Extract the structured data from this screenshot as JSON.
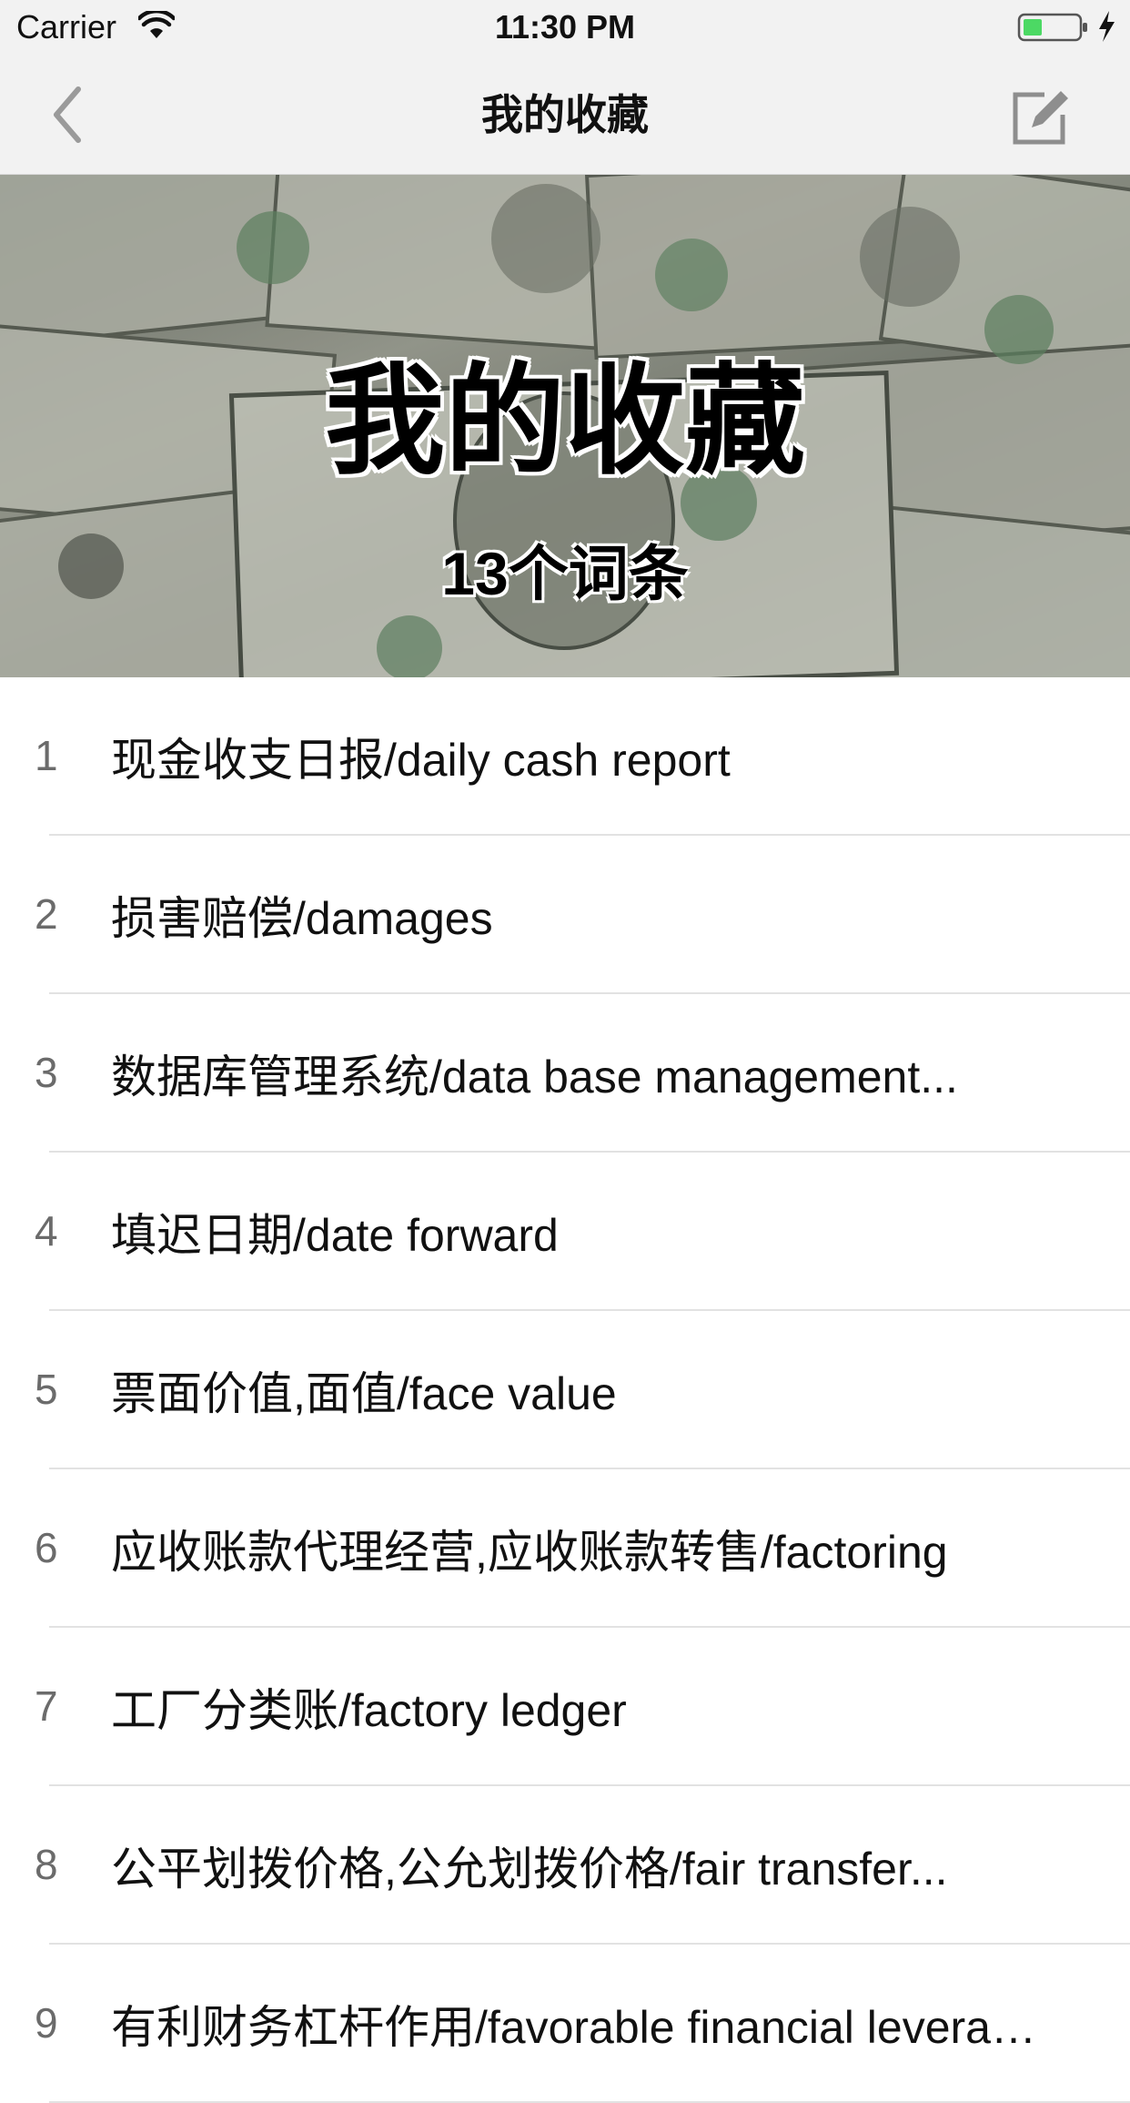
{
  "status_bar": {
    "carrier": "Carrier",
    "time": "11:30 PM"
  },
  "nav": {
    "title": "我的收藏",
    "back_icon": "chevron-left-icon",
    "edit_icon": "edit-icon"
  },
  "banner": {
    "title": "我的收藏",
    "count": "13个词条"
  },
  "items": [
    {
      "index": "1",
      "text": "现金收支日报/daily cash report"
    },
    {
      "index": "2",
      "text": "损害赔偿/damages"
    },
    {
      "index": "3",
      "text": "数据库管理系统/data base management..."
    },
    {
      "index": "4",
      "text": "填迟日期/date forward"
    },
    {
      "index": "5",
      "text": "票面价值,面值/face value"
    },
    {
      "index": "6",
      "text": "应收账款代理经营,应收账款转售/factoring"
    },
    {
      "index": "7",
      "text": "工厂分类账/factory ledger"
    },
    {
      "index": "8",
      "text": "公平划拨价格,公允划拨价格/fair transfer..."
    },
    {
      "index": "9",
      "text": "有利财务杠杆作用/favorable financial leverage"
    }
  ],
  "colors": {
    "bar_background": "#f2f2f2",
    "icon_gray": "#9a9a9a",
    "battery_green": "#4cd964"
  }
}
